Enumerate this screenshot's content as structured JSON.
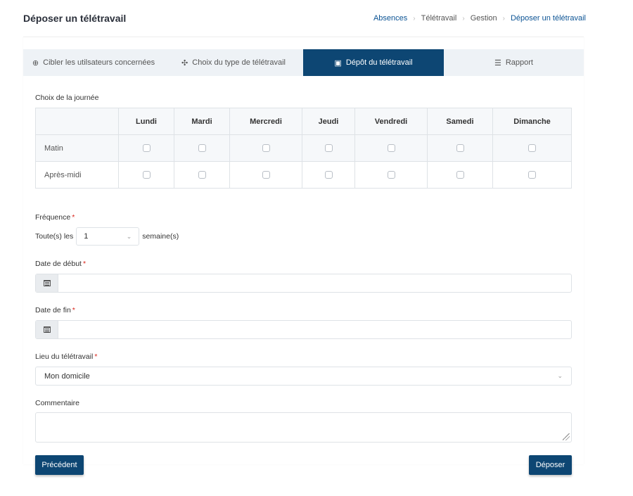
{
  "header": {
    "title": "Déposer un télétravail",
    "breadcrumb": [
      "Absences",
      "Télétravail",
      "Gestion",
      "Déposer un télétravail"
    ]
  },
  "tabs": [
    {
      "label": "Cibler les utilsateurs concernées",
      "icon": "crosshair-icon",
      "active": false
    },
    {
      "label": "Choix du type de télétravail",
      "icon": "move-arrows-icon",
      "active": false
    },
    {
      "label": "Dépôt du télétravail",
      "icon": "calendar-check-icon",
      "active": true
    },
    {
      "label": "Rapport",
      "icon": "list-check-icon",
      "active": false
    }
  ],
  "schedule": {
    "label": "Choix de la journée",
    "days": [
      "Lundi",
      "Mardi",
      "Mercredi",
      "Jeudi",
      "Vendredi",
      "Samedi",
      "Dimanche"
    ],
    "rows": [
      "Matin",
      "Après-midi"
    ]
  },
  "frequency": {
    "label": "Fréquence",
    "prefix": "Toute(s) les",
    "value": "1",
    "suffix": "semaine(s)"
  },
  "start_date": {
    "label": "Date de début",
    "value": ""
  },
  "end_date": {
    "label": "Date de fin",
    "value": ""
  },
  "location": {
    "label": "Lieu du télétravail",
    "value": "Mon domicile"
  },
  "comment": {
    "label": "Commentaire",
    "value": ""
  },
  "required_mark": "*",
  "buttons": {
    "previous": "Précédent",
    "submit": "Déposer"
  },
  "colors": {
    "primary": "#0d4673",
    "link": "#0b5394",
    "required": "#d9261c",
    "tab_bg": "#eef2f6"
  }
}
